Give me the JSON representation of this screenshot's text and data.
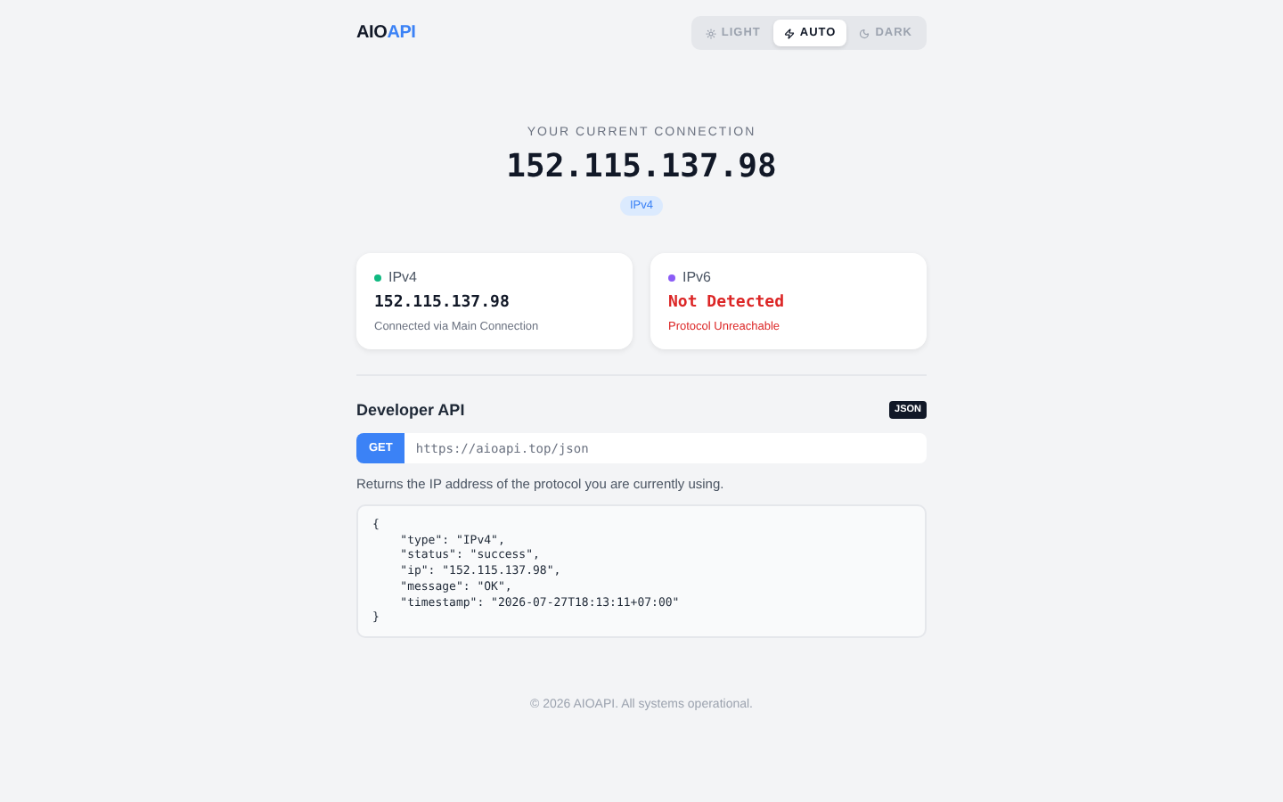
{
  "header": {
    "logo": {
      "first": "AIO",
      "second": "API"
    },
    "theme_toggle": [
      {
        "label": "LIGHT",
        "kind": "sun",
        "selected": false
      },
      {
        "label": "AUTO",
        "kind": "bolt",
        "selected": true
      },
      {
        "label": "DARK",
        "kind": "moon",
        "selected": false
      }
    ]
  },
  "hero": {
    "heading": "YOUR CURRENT CONNECTION",
    "ip": "152.115.137.98",
    "badge": "IPv4"
  },
  "cards": [
    {
      "protocol": "IPv4",
      "color": "#10b981",
      "value": "152.115.137.98",
      "detected": true,
      "note": "Connected via Main Connection"
    },
    {
      "protocol": "IPv6",
      "color": "#8b5cf6",
      "value": "Not Detected",
      "detected": false,
      "note": "Protocol Unreachable"
    }
  ],
  "api": {
    "title": "Developer API",
    "format": "JSON",
    "method": "GET",
    "url": "https://aioapi.top/json",
    "description": "Returns the IP address of the protocol you are currently using.",
    "response": [
      "{",
      "    \"type\": \"IPv4\",",
      "    \"status\": \"success\",",
      "    \"ip\": \"152.115.137.98\",",
      "    \"message\": \"OK\",",
      "    \"timestamp\": \"2026-07-27T18:13:11+07:00\"",
      "}"
    ]
  },
  "footer": "© 2026 AIOAPI. All systems operational."
}
